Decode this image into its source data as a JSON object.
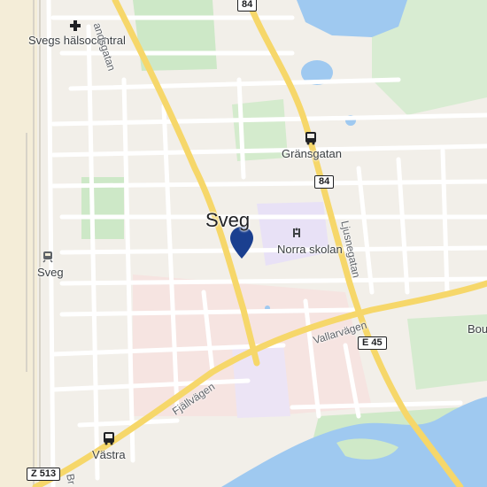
{
  "map": {
    "city_label": "Sveg",
    "pois": {
      "health_center": "Svegs hälsocentral",
      "school": "Norra skolan",
      "bus_stop_gransgatan": "Gränsgatan",
      "bus_stop_vastra": "Västra",
      "train_station": "Sveg",
      "partial_bou": "Bou"
    },
    "streets": {
      "landsgatan": "andsgatan",
      "ljusnegatan": "Ljusnegatan",
      "vallarvagen": "Vallarvägen",
      "fjallvagen": "Fjällvägen",
      "partial_br": "Br"
    },
    "road_shields": {
      "r84_top": "84",
      "r84_mid": "84",
      "e45": "E 45",
      "z513": "Z 513"
    },
    "colors": {
      "background": "#f2efe9",
      "water": "#9fc9f0",
      "park": "#cde8c7",
      "major_road": "#f6d76a",
      "road": "#ffffff",
      "pin": "#1a3f8f",
      "residential": "#f7e3df",
      "school_area": "#e8e1f6"
    },
    "icons": {
      "pin": "location-pin-icon",
      "bus": "bus-icon",
      "train": "train-icon",
      "hospital": "hospital-icon",
      "school": "school-icon"
    }
  }
}
